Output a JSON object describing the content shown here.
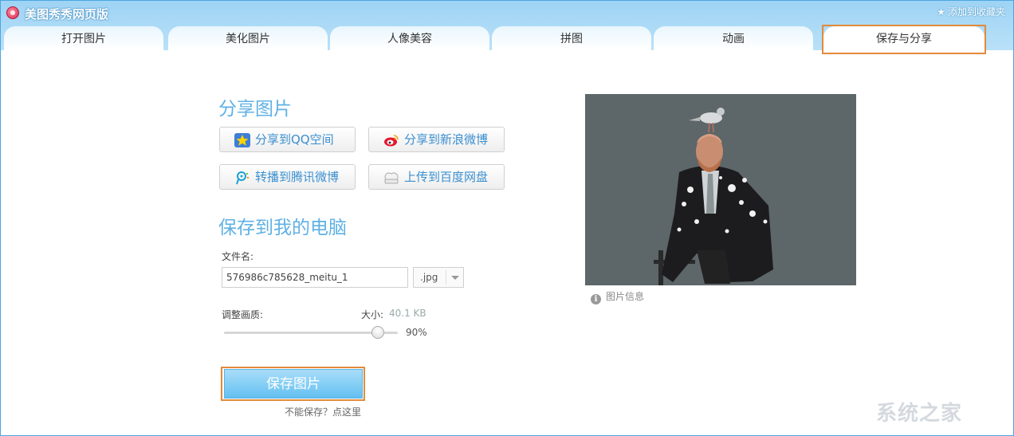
{
  "app": {
    "title": "美图秀秀网页版",
    "favorite": "添加到收藏夹"
  },
  "tabs": [
    {
      "label": "打开图片"
    },
    {
      "label": "美化图片"
    },
    {
      "label": "人像美容"
    },
    {
      "label": "拼图"
    },
    {
      "label": "动画"
    },
    {
      "label": "保存与分享",
      "active": true
    }
  ],
  "share": {
    "title": "分享图片",
    "buttons": [
      {
        "label": "分享到QQ空间",
        "icon": "qzone-star-icon"
      },
      {
        "label": "分享到新浪微博",
        "icon": "weibo-icon"
      },
      {
        "label": "转播到腾讯微博",
        "icon": "tencent-weibo-icon"
      },
      {
        "label": "上传到百度网盘",
        "icon": "baidu-cloud-icon"
      }
    ]
  },
  "save": {
    "title": "保存到我的电脑",
    "filename_label": "文件名:",
    "filename_value": "576986c785628_meitu_1",
    "extension": ".jpg",
    "quality_label": "调整画质:",
    "size_label": "大小:",
    "size_value": "40.1 KB",
    "quality_percent": 90,
    "quality_text": "90%",
    "save_button": "保存图片",
    "cant_save": "不能保存？点这里"
  },
  "preview": {
    "info_label": "图片信息"
  },
  "watermark": "系统之家",
  "colors": {
    "accent": "#5fb1e4",
    "highlight": "#e38a3a",
    "header": "#9ed3f4"
  }
}
